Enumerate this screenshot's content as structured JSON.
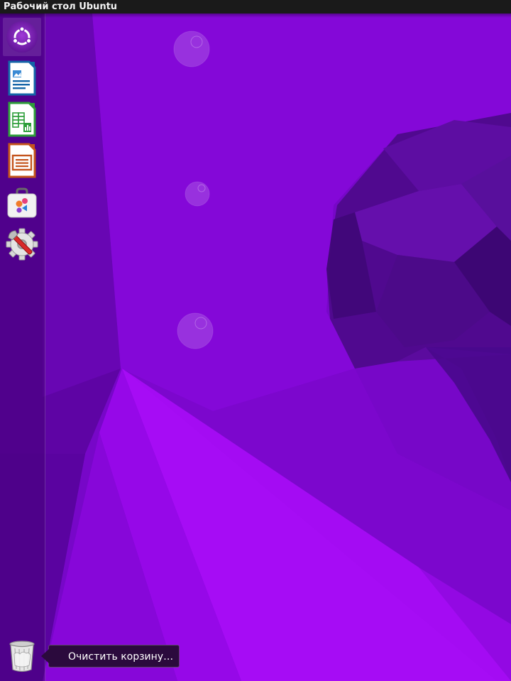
{
  "top_panel": {
    "title": "Рабочий стол Ubuntu"
  },
  "launcher": {
    "items": [
      {
        "name": "ubuntu-dash",
        "icon": "ubuntu-logo-icon",
        "active": true
      },
      {
        "name": "libreoffice-writer",
        "icon": "writer-document-icon"
      },
      {
        "name": "libreoffice-calc",
        "icon": "calc-spreadsheet-icon"
      },
      {
        "name": "libreoffice-impress",
        "icon": "impress-presentation-icon"
      },
      {
        "name": "ubuntu-software",
        "icon": "software-center-bag-icon"
      },
      {
        "name": "system-settings",
        "icon": "settings-gear-wrench-icon"
      }
    ],
    "trash": {
      "icon": "trash-icon"
    }
  },
  "tooltip": {
    "text": "Очистить корзину…"
  },
  "colors": {
    "wallpaper_base": "#6a06b8",
    "wallpaper_bright": "#a90bff",
    "panel": "#1a1a1a",
    "tooltip_bg": "#2b0a3d"
  }
}
